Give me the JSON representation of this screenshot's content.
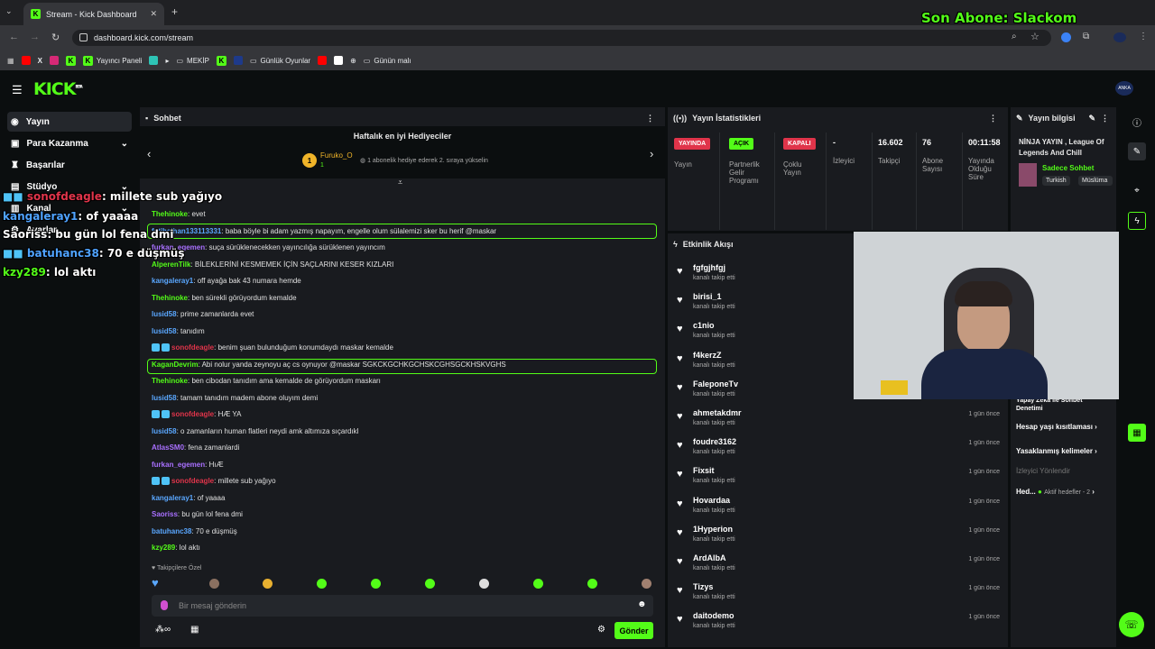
{
  "browser": {
    "tab_title": "Stream - Kick Dashboard",
    "url": "dashboard.kick.com/stream",
    "bookmarks": [
      "Yayıncı Paneli",
      "MEKİP",
      "Günlük Oyunlar",
      "Günün malı"
    ]
  },
  "overlay": {
    "son_abone": "Son Abone: Slackom",
    "chat": [
      {
        "user": "sonofdeagle",
        "text": ": millete sub yağıyo"
      },
      {
        "user": "kangaleray1",
        "text": ": of yaaaa"
      },
      {
        "user": "Saoriss",
        "text": ": bu gün lol fena dmi"
      },
      {
        "user": "batuhanc38",
        "text": ": 70 e düşmüş"
      },
      {
        "user": "kzy289",
        "text": ": lol aktı"
      }
    ]
  },
  "app": {
    "logo": "KICK",
    "logo_tag": "BETA",
    "avatar": "ANKA"
  },
  "sidebar": {
    "items": [
      {
        "label": "Yayın"
      },
      {
        "label": "Para Kazanma"
      },
      {
        "label": "Başarılar"
      },
      {
        "label": "Stüdyo"
      },
      {
        "label": "Kanal"
      },
      {
        "label": "Ayarlar"
      }
    ]
  },
  "chat": {
    "title": "Sohbet",
    "gifters_title": "Haftalık en iyi Hediyeciler",
    "gifter_rank": "1",
    "gifter_name": "Furuko_O",
    "gifter_count": "1",
    "gifter_hint": "1 abonelik hediye ederek 2. sıraya yükselin",
    "messages": [
      {
        "user": "Thehinoke",
        "color": "green",
        "text": ": evet"
      },
      {
        "user": "fatihcihan133113331",
        "color": "blue",
        "text": ": baba böyle bi adam yazmış napayım, engelle olum sülalemizi sker bu herif @maskar",
        "highlight": true
      },
      {
        "user": "furkan_egemen",
        "color": "purple",
        "text": ": suça sürüklenecekken yayıncılığa sürüklenen yayıncım"
      },
      {
        "user": "AlperenTilk",
        "color": "green",
        "text": ": BİLEKLERİNİ KESMEMEK İÇİN SAÇLARINI KESER KIZLARI"
      },
      {
        "user": "kangaleray1",
        "color": "blue",
        "text": ": off ayağa bak 43 numara hemde"
      },
      {
        "user": "Thehinoke",
        "color": "green",
        "text": ": ben sürekli görüyordum kemalde"
      },
      {
        "user": "lusid58",
        "color": "blue",
        "text": ": prime zamanlarda evet"
      },
      {
        "user": "lusid58",
        "color": "blue",
        "text": ": tanıdım"
      },
      {
        "user": "sonofdeagle",
        "color": "red",
        "text": ": benim şuan bulunduğum konumdaydı maskar kemalde"
      },
      {
        "user": "KaganDevrim",
        "color": "green",
        "text": ": Abi nolur yanda zeynoyu aç cs oynuyor @maskar SGKCKGCHKGCHSKCGHSGCKHSKVGHS",
        "highlight": true
      },
      {
        "user": "Thehinoke",
        "color": "green",
        "text": ": ben cibodan tanıdım ama kemalde de görüyordum maskarı"
      },
      {
        "user": "lusid58",
        "color": "blue",
        "text": ": tamam tanıdım madem abone oluyım demi"
      },
      {
        "user": "sonofdeagle",
        "color": "red",
        "text": ": HÆ YA"
      },
      {
        "user": "lusid58",
        "color": "blue",
        "text": ": o zamanların human flatleri neydi amk altımıza sıçardıkl"
      },
      {
        "user": "AtlasSM0",
        "color": "purple",
        "text": ": fena zamanlardi"
      },
      {
        "user": "furkan_egemen",
        "color": "purple",
        "text": ": HıÆ"
      },
      {
        "user": "sonofdeagle",
        "color": "red",
        "text": ": millete sub yağıyo"
      },
      {
        "user": "kangaleray1",
        "color": "blue",
        "text": ": of yaaaa"
      },
      {
        "user": "Saoriss",
        "color": "purple",
        "text": ": bu gün lol fena dmi"
      },
      {
        "user": "batuhanc38",
        "color": "blue",
        "text": ": 70 e düşmüş"
      },
      {
        "user": "kzy289",
        "color": "green",
        "text": ": lol aktı"
      }
    ],
    "followers_label": "Takipçilere Özel",
    "input_placeholder": "Bir mesaj gönderin",
    "send_label": "Gönder"
  },
  "stats": {
    "title": "Yayın İstatistikleri",
    "items": [
      {
        "pill": "YAYINDA",
        "pill_color": "#e0344a",
        "label": "Yayın"
      },
      {
        "pill": "AÇIK",
        "pill_color": "#53fc18",
        "label": "Partnerlik Gelir Programı"
      },
      {
        "pill": "KAPALI",
        "pill_color": "#e0344a",
        "label": "Çoklu Yayın"
      },
      {
        "value": "-",
        "label": "İzleyici"
      },
      {
        "value": "16.602",
        "label": "Takipçi"
      },
      {
        "value": "76",
        "label": "Abone Sayısı"
      },
      {
        "value": "00:11:58",
        "label": "Yayında Olduğu Süre"
      }
    ]
  },
  "activity": {
    "title": "Etkinlik Akışı",
    "events": [
      {
        "name": "fgfgjhfgj",
        "sub": "kanalı takip etti",
        "time": ""
      },
      {
        "name": "birisi_1",
        "sub": "kanalı takip etti",
        "time": ""
      },
      {
        "name": "c1nio",
        "sub": "kanalı takip etti",
        "time": ""
      },
      {
        "name": "f4kerzZ",
        "sub": "kanalı takip etti",
        "time": ""
      },
      {
        "name": "FaleponeTv",
        "sub": "kanalı takip etti",
        "time": ""
      },
      {
        "name": "ahmetakdmr",
        "sub": "kanalı takip etti",
        "time": "1 gün önce"
      },
      {
        "name": "foudre3162",
        "sub": "kanalı takip etti",
        "time": "1 gün önce"
      },
      {
        "name": "Fixsit",
        "sub": "kanalı takip etti",
        "time": "1 gün önce"
      },
      {
        "name": "Hovardaa",
        "sub": "kanalı takip etti",
        "time": "1 gün önce"
      },
      {
        "name": "1Hyperion",
        "sub": "kanalı takip etti",
        "time": "1 gün önce"
      },
      {
        "name": "ArdAlbA",
        "sub": "kanalı takip etti",
        "time": "1 gün önce"
      },
      {
        "name": "Tizys",
        "sub": "kanalı takip etti",
        "time": "1 gün önce"
      },
      {
        "name": "daitodemo",
        "sub": "kanalı takip etti",
        "time": "1 gün önce"
      }
    ]
  },
  "stream_info": {
    "title": "Yayın bilgisi",
    "stream_title": "NİNJA YAYIN , League Of Legends And Chill",
    "category": "Sadece Sohbet",
    "tags": [
      "Turkish",
      "Müslüma"
    ],
    "mod_items": [
      {
        "label": "Yapay Zeka ile Sohbet Denetimi"
      },
      {
        "label": "Hesap yaşı kısıtlaması"
      },
      {
        "label": "Yasaklanmış kelimeler"
      },
      {
        "label": "İzleyici Yönlendir"
      },
      {
        "label": "Hed...",
        "extra": "Aktif hedefler - 2"
      }
    ]
  }
}
